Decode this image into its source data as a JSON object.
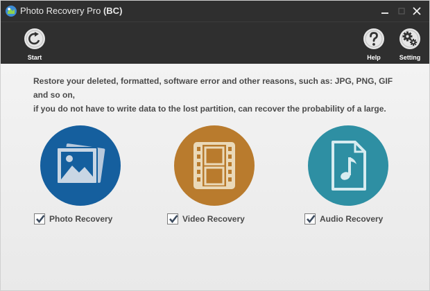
{
  "window": {
    "title": "Photo Recovery Pro",
    "title_suffix": "(BC)",
    "icons": {
      "app": "recovery-app-icon",
      "minimize": "minimize-icon",
      "maximize": "maximize-icon",
      "close": "close-icon"
    }
  },
  "toolbar": {
    "start_label": "Start",
    "help_label": "Help",
    "setting_label": "Setting",
    "icons": {
      "start": "refresh-icon",
      "help": "question-mark-icon",
      "setting": "gears-icon"
    }
  },
  "main": {
    "description_line1": "Restore your deleted, formatted, software error and other reasons, such as: JPG, PNG, GIF and so on,",
    "description_line2": "if you do not have to write data to the lost partition, can recover the probability of a large.",
    "options": [
      {
        "label": "Photo Recovery",
        "checked": true,
        "color": "#155f9e",
        "icon": "photo-icon"
      },
      {
        "label": "Video Recovery",
        "checked": true,
        "color": "#b97b2d",
        "icon": "film-icon"
      },
      {
        "label": "Audio Recovery",
        "checked": true,
        "color": "#2e8fa3",
        "icon": "music-file-icon"
      }
    ]
  }
}
